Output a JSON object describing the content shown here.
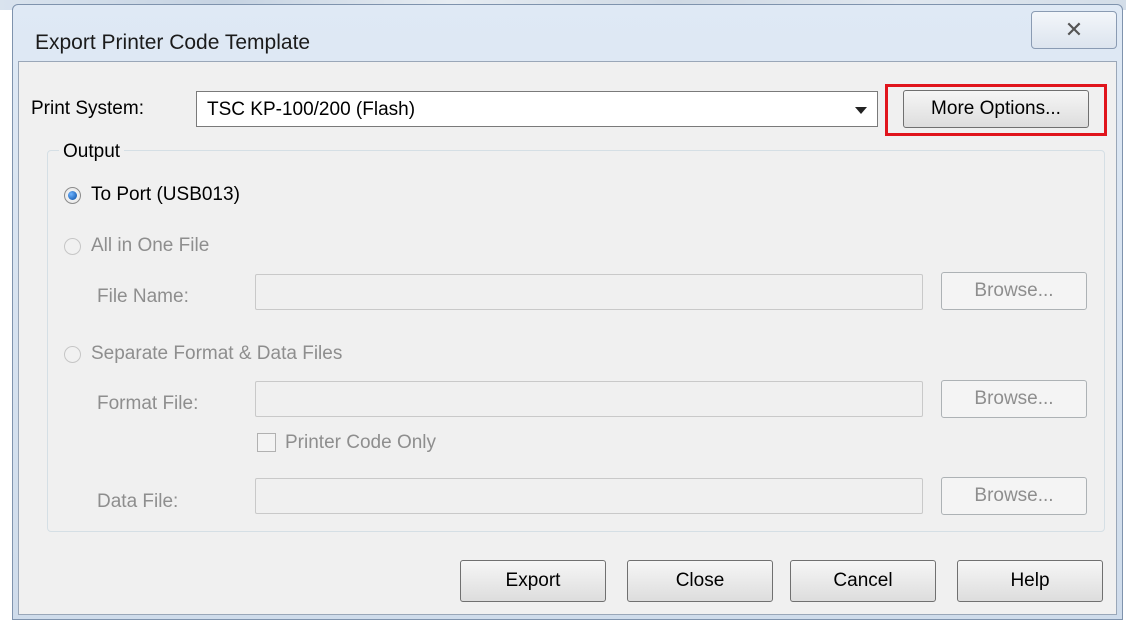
{
  "window": {
    "title": "Export Printer Code Template",
    "close_glyph": "✕"
  },
  "print_system": {
    "label": "Print System:",
    "selected": "TSC KP-100/200 (Flash)",
    "more_options": "More Options..."
  },
  "output": {
    "caption": "Output",
    "to_port": "To Port (USB013)",
    "all_in_one": "All in One File",
    "file_name_label": "File Name:",
    "separate_files": "Separate Format & Data Files",
    "format_file_label": "Format File:",
    "printer_code_only": "Printer Code Only",
    "data_file_label": "Data File:",
    "browse": "Browse..."
  },
  "buttons": {
    "export": "Export",
    "close": "Close",
    "cancel": "Cancel",
    "help": "Help"
  },
  "colors": {
    "highlight": "#e0141c",
    "title_bg": "#dfe9f5",
    "client_bg": "#f0f0f0"
  }
}
